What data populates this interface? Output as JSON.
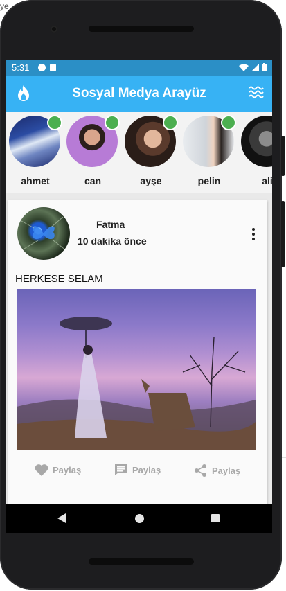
{
  "corner_text": "ye",
  "status_bar": {
    "time": "5:31"
  },
  "app_bar": {
    "title": "Sosyal Medya Arayüz",
    "accent_color": "#37b2f4",
    "left_icon": "flame-icon",
    "right_icon": "waves-icon"
  },
  "stories": [
    {
      "name": "ahmet",
      "online": true
    },
    {
      "name": "can",
      "online": true
    },
    {
      "name": "ayşe",
      "online": true
    },
    {
      "name": "pelin",
      "online": true
    },
    {
      "name": "ali",
      "online": false
    }
  ],
  "post": {
    "author": "Fatma",
    "time_ago": "10 dakika önce",
    "text": "HERKESE SELAM",
    "actions": [
      {
        "icon": "heart-icon",
        "label": "Paylaş"
      },
      {
        "icon": "comment-icon",
        "label": "Paylaş"
      },
      {
        "icon": "share-icon",
        "label": "Paylaş"
      }
    ]
  }
}
